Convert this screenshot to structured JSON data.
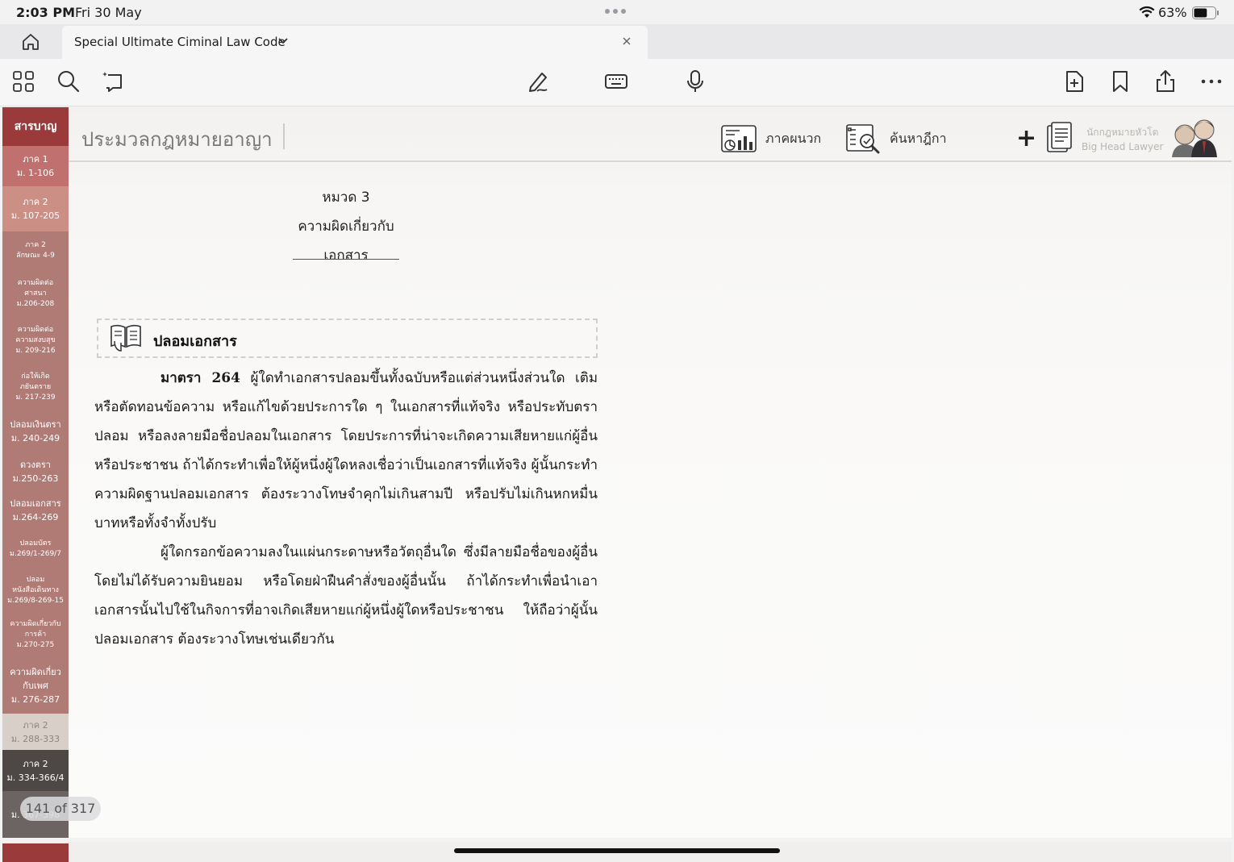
{
  "status": {
    "time": "2:03 PM",
    "date": "Fri 30 May",
    "battery_percent": "63%",
    "battery_level": 0.63
  },
  "tab": {
    "title": "Special Ultimate Ciminal Law Code"
  },
  "toolbar": {
    "left_icons": [
      "grid-icon",
      "search-icon",
      "lasso-icon"
    ],
    "center_icons": [
      "pen-icon",
      "keyboard-icon",
      "microphone-icon"
    ],
    "right_icons": [
      "add-page-icon",
      "bookmark-icon",
      "share-icon",
      "more-icon"
    ]
  },
  "header": {
    "title": "ประมวลกฎหมายอาญา",
    "appendix_label": "ภาคผนวก",
    "search_label": "ค้นหาฎีกา",
    "brand_line1": "นักกฎหมายหัวโต",
    "brand_line2": "Big Head Lawyer"
  },
  "sidebar": {
    "items": [
      {
        "lines": [
          "สารบาญ"
        ],
        "color": "#9a3a3a"
      },
      {
        "lines": [
          "ภาค 1",
          "ม. 1-106"
        ],
        "color": "#c0706f"
      },
      {
        "lines": [
          "ภาค 2",
          "ม. 107-205"
        ],
        "color": "#cc8f86"
      },
      {
        "lines": [
          "ภาค 2",
          "ลักษณะ 4-9"
        ],
        "color": "#b07a75"
      },
      {
        "lines": [
          "ความผิดต่อ",
          "ศาสนา",
          "ม.206-208"
        ],
        "color": "#b07a75"
      },
      {
        "lines": [
          "ความผิดต่อ",
          "ความสงบสุข",
          "ม. 209-216"
        ],
        "color": "#b07a75"
      },
      {
        "lines": [
          "ก่อให้เกิด",
          "ภยันตราย",
          "ม. 217-239"
        ],
        "color": "#b07a75"
      },
      {
        "lines": [
          "ปลอมเงินตรา",
          "ม. 240-249"
        ],
        "color": "#b07a75"
      },
      {
        "lines": [
          "ดวงตรา",
          "ม.250-263"
        ],
        "color": "#b07a75"
      },
      {
        "lines": [
          "ปลอมเอกสาร",
          "ม.264-269"
        ],
        "color": "#b07a75"
      },
      {
        "lines": [
          "ปลอมบัตร",
          "ม.269/1-269/7"
        ],
        "color": "#b07a75"
      },
      {
        "lines": [
          "ปลอม",
          "หนังสือเดินทาง",
          "ม.269/8-269-15"
        ],
        "color": "#b07a75"
      },
      {
        "lines": [
          "ความผิดเกี่ยวกับ",
          "การค้า",
          "ม.270-275"
        ],
        "color": "#b07a75"
      },
      {
        "lines": [
          "ความผิดเกี่ยว",
          "กับเพศ",
          "ม. 276-287"
        ],
        "color": "#b07a75"
      },
      {
        "lines": [
          "ภาค 2",
          "ม. 288-333"
        ],
        "color": "#d8cfc8"
      },
      {
        "lines": [
          "ภาค 2",
          "ม. 334-366/4"
        ],
        "color": "#4d4746"
      },
      {
        "lines": [
          "ม. 367-398"
        ],
        "color": "#6b6463"
      }
    ],
    "page_indicator": "141 of 317"
  },
  "content": {
    "chapter_line1": "หมวด 3",
    "chapter_line2": "ความผิดเกี่ยวกับเอกสาร",
    "section_title": "ปลอมเอกสาร",
    "article_label": "มาตรา 264",
    "paragraph1": "ผู้ใดทำเอกสารปลอมขึ้นทั้งฉบับหรือแต่ส่วนหนึ่งส่วนใด เติมหรือตัดทอนข้อความ หรือแก้ไขด้วยประการใด ๆ ในเอกสารที่แท้จริง หรือประทับตราปลอม หรือลงลายมือชื่อปลอมในเอกสาร โดยประการที่น่าจะเกิดความเสียหายแก่ผู้อื่นหรือประชาชน ถ้าได้กระทำเพื่อให้ผู้หนึ่งผู้ใดหลงเชื่อว่าเป็นเอกสารที่แท้จริง ผู้นั้นกระทำความผิดฐานปลอมเอกสาร ต้องระวางโทษจำคุกไม่เกินสามปี หรือปรับไม่เกินหกหมื่นบาทหรือทั้งจำทั้งปรับ",
    "paragraph2": "ผู้ใดกรอกข้อความลงในแผ่นกระดาษหรือวัตถุอื่นใด ซึ่งมีลายมือชื่อของผู้อื่นโดยไม่ได้รับความยินยอม หรือโดยฝ่าฝืนคำสั่งของผู้อื่นนั้น ถ้าได้กระทำเพื่อนำเอาเอกสารนั้นไปใช้ในกิจการที่อาจเกิดเสียหายแก่ผู้หนึ่งผู้ใดหรือประชาชน ให้ถือว่าผู้นั้นปลอมเอกสาร ต้องระวางโทษเช่นเดียวกัน"
  }
}
